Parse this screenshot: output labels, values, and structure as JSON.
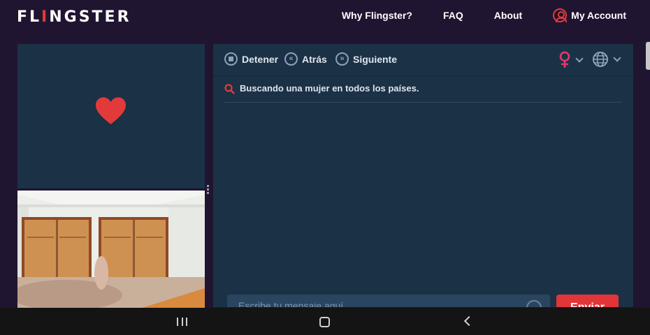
{
  "header": {
    "logo_prefix": "FL",
    "logo_accent": "I",
    "logo_suffix": "NGSTER",
    "nav": [
      "Why Flingster?",
      "FAQ",
      "About"
    ],
    "account_label": "My Account"
  },
  "chat": {
    "stop_label": "Detener",
    "back_label": "Atrás",
    "next_label": "Siguiente",
    "gender_filter_icon": "female-icon",
    "country_filter_icon": "globe-icon",
    "status_text": "Buscando una mujer en todos los países.",
    "message_placeholder": "Escribe tu mensaje aquí",
    "send_label": "Enviar"
  },
  "colors": {
    "background": "#201530",
    "panel": "#1b3146",
    "accent": "#e23a3a",
    "send_button": "#e2353a"
  },
  "system_nav": [
    "recent-apps-icon",
    "home-icon",
    "back-icon"
  ]
}
